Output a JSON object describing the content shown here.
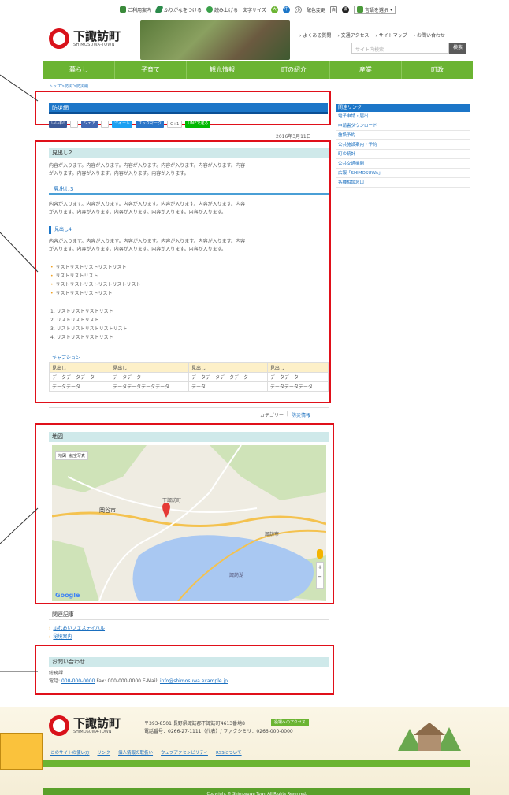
{
  "util_bar": {
    "items": [
      "ご利用案内",
      "ふりがなをつける",
      "読み上げる",
      "文字サイズ",
      "配色変更",
      "言語を選択"
    ],
    "font_sizes": [
      "大",
      "中",
      "小"
    ],
    "color_modes": [
      "白",
      "黒"
    ]
  },
  "logo": {
    "name_jp": "下諏訪町",
    "name_en": "SHIMOSUWA-TOWN"
  },
  "header_links": [
    "よくある質問",
    "交通アクセス",
    "サイトマップ",
    "お問い合わせ"
  ],
  "search": {
    "placeholder": "サイト内検索",
    "button": "検索"
  },
  "global_nav": [
    "暮らし",
    "子育て",
    "観光情報",
    "町の紹介",
    "産業",
    "町政"
  ],
  "breadcrumb": "トップ＞防災＞防災網",
  "page_title": "防災網",
  "social": [
    "いいね!",
    "シェア",
    "ツイート",
    "ブックマーク",
    "G+1",
    "LINEで送る"
  ],
  "date": "2016年3月11日",
  "sections": {
    "h2": "見出し2",
    "h2_text": [
      "内容が入ります。内容が入ります。内容が入ります。内容が入ります。内容が入ります。内容",
      "が入ります。内容が入ります。内容が入ります。内容が入ります。"
    ],
    "h3": "見出し3",
    "h3_text": [
      "内容が入ります。内容が入ります。内容が入ります。内容が入ります。内容が入ります。内容",
      "が入ります。内容が入ります。内容が入ります。内容が入ります。内容が入ります。"
    ],
    "h4": "見出し4",
    "h4_text": [
      "内容が入ります。内容が入ります。内容が入ります。内容が入ります。内容が入ります。内容",
      "が入ります。内容が入ります。内容が入ります。内容が入ります。内容が入ります。"
    ],
    "bullets": [
      "リストリストリストリストリスト",
      "リストリストリスト",
      "リストリストリストリストリストリスト",
      "リストリストリストリスト"
    ],
    "numbered": [
      "1. リストリストリストリスト",
      "2. リストリストリスト",
      "3. リストリストリストリストリスト",
      "4. リストリストリストリスト"
    ],
    "caption": "キャプション",
    "table": {
      "headers": [
        "見出し",
        "見出し",
        "見出し",
        "見出し"
      ],
      "rows": [
        [
          "データデータデータ",
          "データデータ",
          "データデータデータデータ",
          "データデータ"
        ],
        [
          "データデータ",
          "データデータデータデータ",
          "データ",
          "データデータデータ"
        ]
      ]
    }
  },
  "category": {
    "label": "カテゴリー",
    "value": "防災情報"
  },
  "map": {
    "heading": "地図",
    "map_types": [
      "地図",
      "航空写真"
    ],
    "labels": [
      "岡谷市",
      "下諏訪町",
      "諏訪湖",
      "諏訪市"
    ],
    "google": "Google"
  },
  "related": {
    "heading": "関連記事",
    "items": [
      "ふれあいフェスティバル",
      "秘境案内"
    ]
  },
  "contact": {
    "heading": "お問い合わせ",
    "dept": "総務課",
    "phone_label": "電話:",
    "phone": "000-000-0000",
    "fax": "Fax: 000-000-0000",
    "mail_label": "E-Mail:",
    "mail": "info@shimosuwa.example.jp"
  },
  "sidebar": {
    "heading": "関連リンク",
    "items": [
      "電子申請・届出",
      "申請書ダウンロード",
      "施設予約",
      "公共施設案内・予約",
      "町の統計",
      "公共交通機関",
      "広報「SHIMOSUWA」",
      "各種相談窓口"
    ]
  },
  "footer": {
    "addr1": "〒393-8501 長野県諏訪郡下諏訪町4613番地8",
    "addr2": "電話番号：0266-27-1111（代表）/ ファクシミリ：0266-000-0000",
    "access": "役場へのアクセス",
    "links": [
      "このサイトの使い方",
      "リンク",
      "個人情報の取扱い",
      "ウェブアクセシビリティ",
      "RSSについて"
    ],
    "copyright": "Copyright © Shimosuwa Town All Rights Reserved."
  },
  "colors": {
    "green": "#6bb432",
    "blue": "#1c76c8",
    "red_outline": "#e0101a",
    "orange": "#fac23c"
  }
}
